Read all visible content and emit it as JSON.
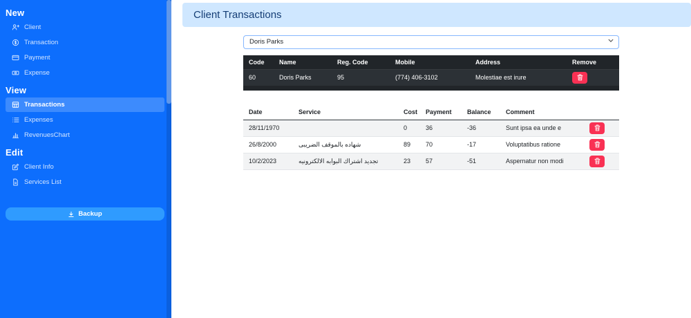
{
  "colors": {
    "sidebar": "#0d6efd",
    "sidebar_active_item": "#3d8bfd",
    "backup_button": "#2f9bff",
    "page_header_bg": "#cfe7ff",
    "page_header_text": "#153e75",
    "dark_table_bg": "#212529",
    "danger": "#f93154"
  },
  "sidebar": {
    "sections": [
      {
        "title": "New",
        "items": [
          {
            "label": "Client",
            "icon": "person-plus-icon"
          },
          {
            "label": "Transaction",
            "icon": "coin-icon"
          },
          {
            "label": "Payment",
            "icon": "credit-card-icon"
          },
          {
            "label": "Expense",
            "icon": "cash-icon"
          }
        ]
      },
      {
        "title": "View",
        "items": [
          {
            "label": "Transactions",
            "icon": "table-icon",
            "active": true
          },
          {
            "label": "Expenses",
            "icon": "list-icon"
          },
          {
            "label": "RevenuesChart",
            "icon": "bar-chart-icon"
          }
        ]
      },
      {
        "title": "Edit",
        "items": [
          {
            "label": "Client Info",
            "icon": "pencil-square-icon"
          },
          {
            "label": "Services List",
            "icon": "file-text-icon"
          }
        ]
      }
    ],
    "backup_label": "Backup"
  },
  "header": {
    "title": "Client Transactions"
  },
  "client_select": {
    "value": "Doris Parks"
  },
  "client_table": {
    "headers": [
      "Code",
      "Name",
      "Reg. Code",
      "Mobile",
      "Address",
      "Remove"
    ],
    "rows": [
      {
        "code": "60",
        "name": "Doris Parks",
        "reg_code": "95",
        "mobile": "(774) 406-3102",
        "address": "Molestiae est irure"
      }
    ]
  },
  "transactions_table": {
    "headers": [
      "Date",
      "Service",
      "Cost",
      "Payment",
      "Balance",
      "Comment"
    ],
    "rows": [
      {
        "date": "28/11/1970",
        "service": "",
        "cost": "0",
        "payment": "36",
        "balance": "-36",
        "comment": "Sunt ipsa ea unde e"
      },
      {
        "date": "26/8/2000",
        "service": "شهاده بالموقف الضريبى",
        "cost": "89",
        "payment": "70",
        "balance": "-17",
        "comment": "Voluptatibus ratione"
      },
      {
        "date": "10/2/2023",
        "service": "تجديد اشتراك البوابه الالكترونيه",
        "cost": "23",
        "payment": "57",
        "balance": "-51",
        "comment": "Aspernatur non modi"
      }
    ]
  }
}
